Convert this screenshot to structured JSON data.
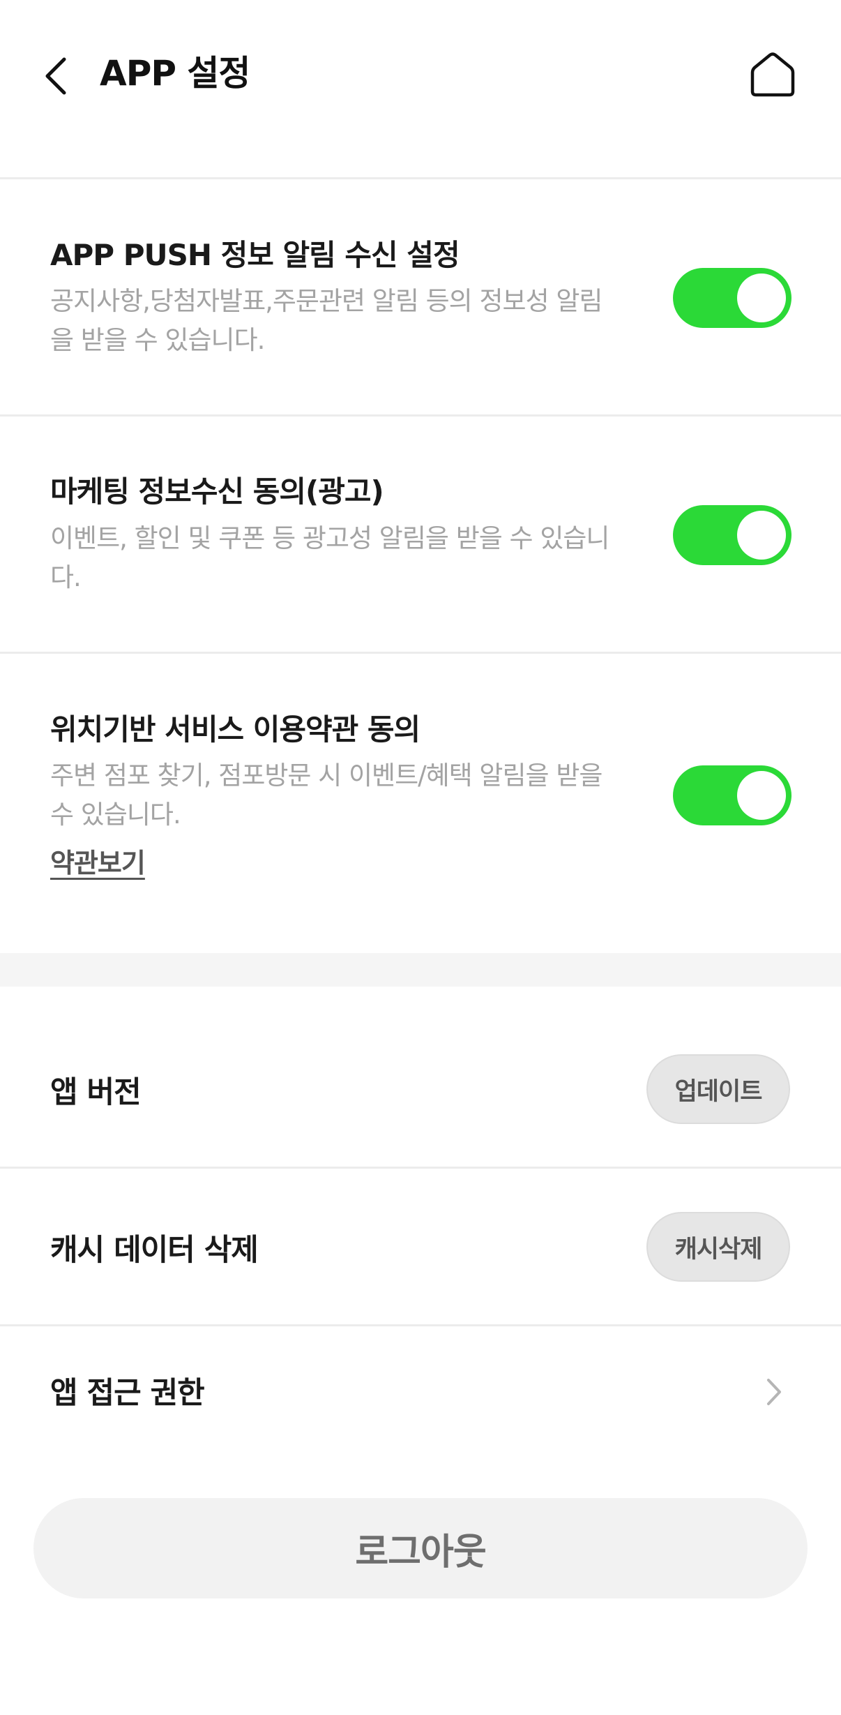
{
  "header": {
    "title": "APP 설정",
    "back_icon": "chevron-left-icon",
    "home_icon": "home-icon"
  },
  "notifications": {
    "push": {
      "title": "APP PUSH 정보 알림 수신 설정",
      "description": "공지사항,당첨자발표,주문관련 알림 등의 정보성 알림을 받을 수 있습니다.",
      "enabled": true
    },
    "marketing": {
      "title": "마케팅 정보수신 동의(광고)",
      "description": "이벤트, 할인 및 쿠폰 등 광고성 알림을 받을 수 있습니다.",
      "enabled": true
    },
    "location": {
      "title": "위치기반 서비스 이용약관 동의",
      "description": "주변 점포 찾기, 점포방문 시 이벤트/혜택 알림을 받을 수 있습니다.",
      "terms_link": "약관보기",
      "enabled": true
    }
  },
  "app": {
    "version": {
      "title": "앱 버전",
      "button": "업데이트"
    },
    "cache": {
      "title": "캐시 데이터 삭제",
      "button": "캐시삭제"
    },
    "permissions": {
      "title": "앱 접근 권한"
    }
  },
  "logout_label": "로그아웃",
  "colors": {
    "toggle_on": "#2bd937",
    "divider": "#ececec",
    "description_text": "#a3a3a3"
  }
}
